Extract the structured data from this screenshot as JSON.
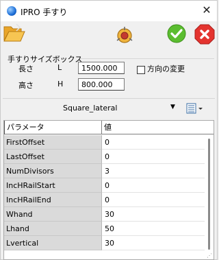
{
  "window": {
    "title": "IPRO 手すり"
  },
  "groupbox": {
    "title": "手すりサイズボックス",
    "length": {
      "label": "長さ",
      "axis": "L",
      "value": "1500.000"
    },
    "height": {
      "label": "高さ",
      "axis": "H",
      "value": "800.000"
    },
    "direction_checkbox": {
      "label": "方向の変更",
      "checked": false
    }
  },
  "combo": {
    "selected": "Square_lateral"
  },
  "grid": {
    "headers": {
      "name": "パラメータ",
      "value": "値"
    },
    "rows": [
      {
        "name": "FirstOffset",
        "value": "0"
      },
      {
        "name": "LastOffset",
        "value": "0"
      },
      {
        "name": "NumDivisors",
        "value": "3"
      },
      {
        "name": "IncHRailStart",
        "value": "0"
      },
      {
        "name": "IncHRailEnd",
        "value": "0"
      },
      {
        "name": "Whand",
        "value": "30"
      },
      {
        "name": "Lhand",
        "value": "50"
      },
      {
        "name": "Lvertical",
        "value": "30"
      }
    ]
  },
  "icons": {
    "title": "app-globe-icon",
    "folder": "folder-open-icon",
    "plugin": "plugin-icon",
    "ok": "checkmark-icon",
    "cancel": "close-icon"
  },
  "colors": {
    "ok": "#58b82e",
    "cancel": "#e0312e",
    "folder": "#f2b43a"
  }
}
